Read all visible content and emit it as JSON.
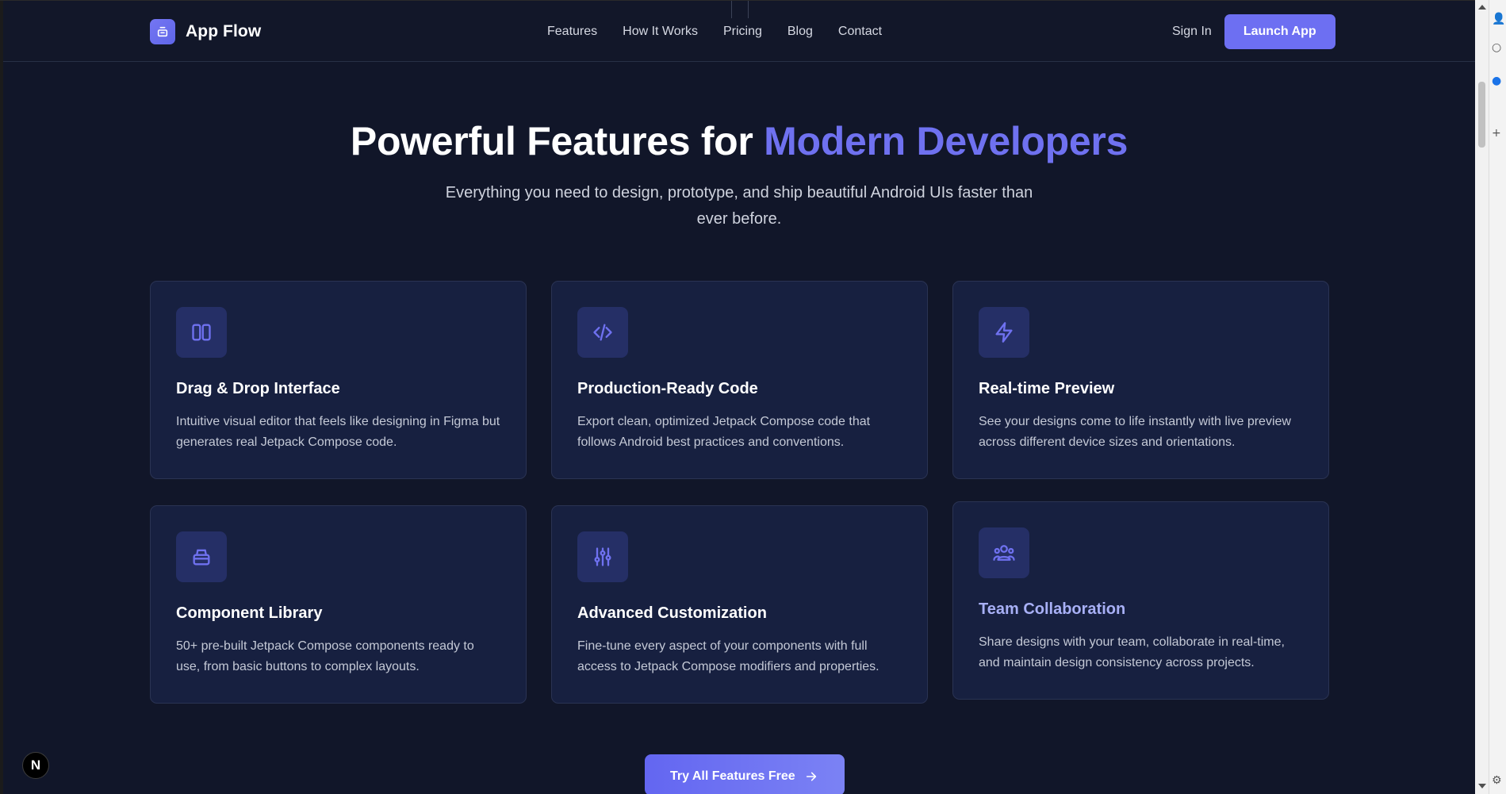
{
  "brand": {
    "name": "App Flow"
  },
  "nav": {
    "links": [
      "Features",
      "How It Works",
      "Pricing",
      "Blog",
      "Contact"
    ],
    "signin": "Sign In",
    "launch": "Launch App"
  },
  "hero": {
    "title_main": "Powerful Features for ",
    "title_accent": "Modern Developers",
    "subtitle": "Everything you need to design, prototype, and ship beautiful Android UIs faster than ever before."
  },
  "features": [
    {
      "icon": "columns-icon",
      "title": "Drag & Drop Interface",
      "desc": "Intuitive visual editor that feels like designing in Figma but generates real Jetpack Compose code."
    },
    {
      "icon": "code-icon",
      "title": "Production-Ready Code",
      "desc": "Export clean, optimized Jetpack Compose code that follows Android best practices and conventions."
    },
    {
      "icon": "lightning-icon",
      "title": "Real-time Preview",
      "desc": "See your designs come to life instantly with live preview across different device sizes and orientations."
    },
    {
      "icon": "package-icon",
      "title": "Component Library",
      "desc": "50+ pre-built Jetpack Compose components ready to use, from basic buttons to complex layouts."
    },
    {
      "icon": "sliders-icon",
      "title": "Advanced Customization",
      "desc": "Fine-tune every aspect of your components with full access to Jetpack Compose modifiers and properties."
    },
    {
      "icon": "team-icon",
      "title": "Team Collaboration",
      "desc": "Share designs with your team, collaborate in real-time, and maintain design consistency across projects."
    }
  ],
  "cta": {
    "label": "Try All Features Free"
  },
  "badge": {
    "label": "N"
  },
  "colors": {
    "background": "#111629",
    "card": "#172040",
    "accent": "#6f71f0",
    "button": "#6d6ff2"
  }
}
